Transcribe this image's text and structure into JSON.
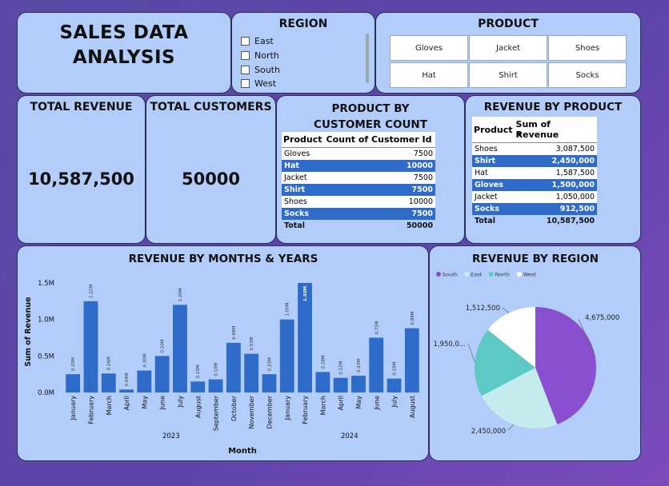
{
  "title": "SALES DATA ANALYSIS",
  "region_slicer": {
    "title": "REGION",
    "options": [
      "East",
      "North",
      "South",
      "West"
    ]
  },
  "product_slicer": {
    "title": "PRODUCT",
    "options": [
      "Gloves",
      "Jacket",
      "Shoes",
      "Hat",
      "Shirt",
      "Socks"
    ]
  },
  "kpis": {
    "revenue": {
      "label": "TOTAL REVENUE",
      "value": "10,587,500"
    },
    "customers": {
      "label": "TOTAL CUSTOMERS",
      "value": "50000"
    }
  },
  "customer_table": {
    "title": "PRODUCT BY CUSTOMER COUNT",
    "headers": [
      "Product",
      "Count of Customer Id"
    ],
    "rows": [
      [
        "Gloves",
        "7500"
      ],
      [
        "Hat",
        "10000"
      ],
      [
        "Jacket",
        "7500"
      ],
      [
        "Shirt",
        "7500"
      ],
      [
        "Shoes",
        "10000"
      ],
      [
        "Socks",
        "7500"
      ]
    ],
    "total_label": "Total",
    "total_value": "50000"
  },
  "revenue_table": {
    "title": "REVENUE BY PRODUCT",
    "headers": [
      "Product",
      "Sum of Revenue"
    ],
    "rows": [
      [
        "Shoes",
        "3,087,500"
      ],
      [
        "Shirt",
        "2,450,000"
      ],
      [
        "Hat",
        "1,587,500"
      ],
      [
        "Gloves",
        "1,500,000"
      ],
      [
        "Jacket",
        "1,050,000"
      ],
      [
        "Socks",
        "912,500"
      ]
    ],
    "total_label": "Total",
    "total_value": "10,587,500"
  },
  "colors": {
    "card": "#b2cdfa",
    "bar": "#2f6bc9",
    "south": "#8a4fd1",
    "east": "#c4ecec",
    "north": "#5cc9c4",
    "west": "#ffffff"
  },
  "chart_data": [
    {
      "type": "bar",
      "title": "REVENUE BY MONTHS & YEARS",
      "xlabel": "Month",
      "ylabel": "Sum of Revenue",
      "y_ticks": [
        "0.0M",
        "0.5M",
        "1.0M",
        "1.5M"
      ],
      "ylim": [
        0,
        1.5
      ],
      "years": [
        {
          "label": "2023",
          "months": [
            "January",
            "February",
            "March",
            "April",
            "May",
            "June",
            "July",
            "August",
            "September",
            "October",
            "November",
            "December"
          ]
        },
        {
          "label": "2024",
          "months": [
            "January",
            "February",
            "March",
            "April",
            "May",
            "June",
            "July",
            "August"
          ]
        }
      ],
      "values": [
        0.25,
        1.25,
        0.26,
        0.04,
        0.3,
        0.5,
        1.2,
        0.15,
        0.18,
        0.68,
        0.53,
        0.25,
        1.0,
        1.5,
        0.28,
        0.2,
        0.23,
        0.75,
        0.19,
        0.88
      ],
      "labels": [
        "0.25M",
        "1.25M",
        "0.26M",
        "0.04M",
        "0.30M",
        "0.50M",
        "1.20M",
        "0.15M",
        "0.18M",
        "0.68M",
        "0.53M",
        "0.25M",
        "1.00M",
        "1.50M",
        "0.28M",
        "0.22M",
        "0.23M",
        "0.75M",
        "0.19M",
        "0.88M"
      ]
    },
    {
      "type": "pie",
      "title": "REVENUE BY REGION",
      "legend": [
        "South",
        "East",
        "North",
        "West"
      ],
      "legend_position": "top-left",
      "slices": [
        {
          "name": "South",
          "value": 4675000,
          "label": "4,675,000"
        },
        {
          "name": "East",
          "value": 2450000,
          "label": "2,450,000"
        },
        {
          "name": "North",
          "value": 1950000,
          "label": "1,950,0..."
        },
        {
          "name": "West",
          "value": 1512500,
          "label": "1,512,500"
        }
      ]
    }
  ]
}
